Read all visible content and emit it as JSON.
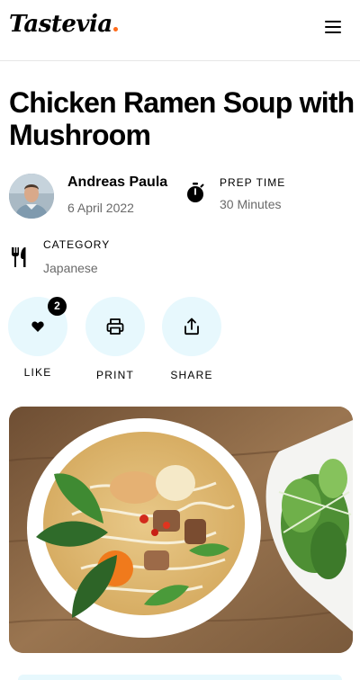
{
  "header": {
    "brand": "Tastevia",
    "menu_icon": "hamburger-menu-icon",
    "brand_dot_color": "#ff6b1a"
  },
  "recipe": {
    "title": "Chicken Ramen Soup with Mushroom",
    "author": {
      "name": "Andreas Paula",
      "date": "6 April 2022"
    },
    "prep_time": {
      "label": "PREP TIME",
      "value": "30 Minutes",
      "icon": "stopwatch-icon"
    },
    "category": {
      "label": "CATEGORY",
      "value": "Japanese",
      "icon": "fork-knife-icon"
    }
  },
  "actions": {
    "like": {
      "label": "LIKE",
      "count": "2",
      "icon": "heart-icon"
    },
    "print": {
      "label": "PRINT",
      "icon": "printer-icon"
    },
    "share": {
      "label": "SHARE",
      "icon": "share-icon"
    },
    "circle_color": "#e7f8fd"
  },
  "hero_image": {
    "subject": "ramen-bowl-photo"
  }
}
